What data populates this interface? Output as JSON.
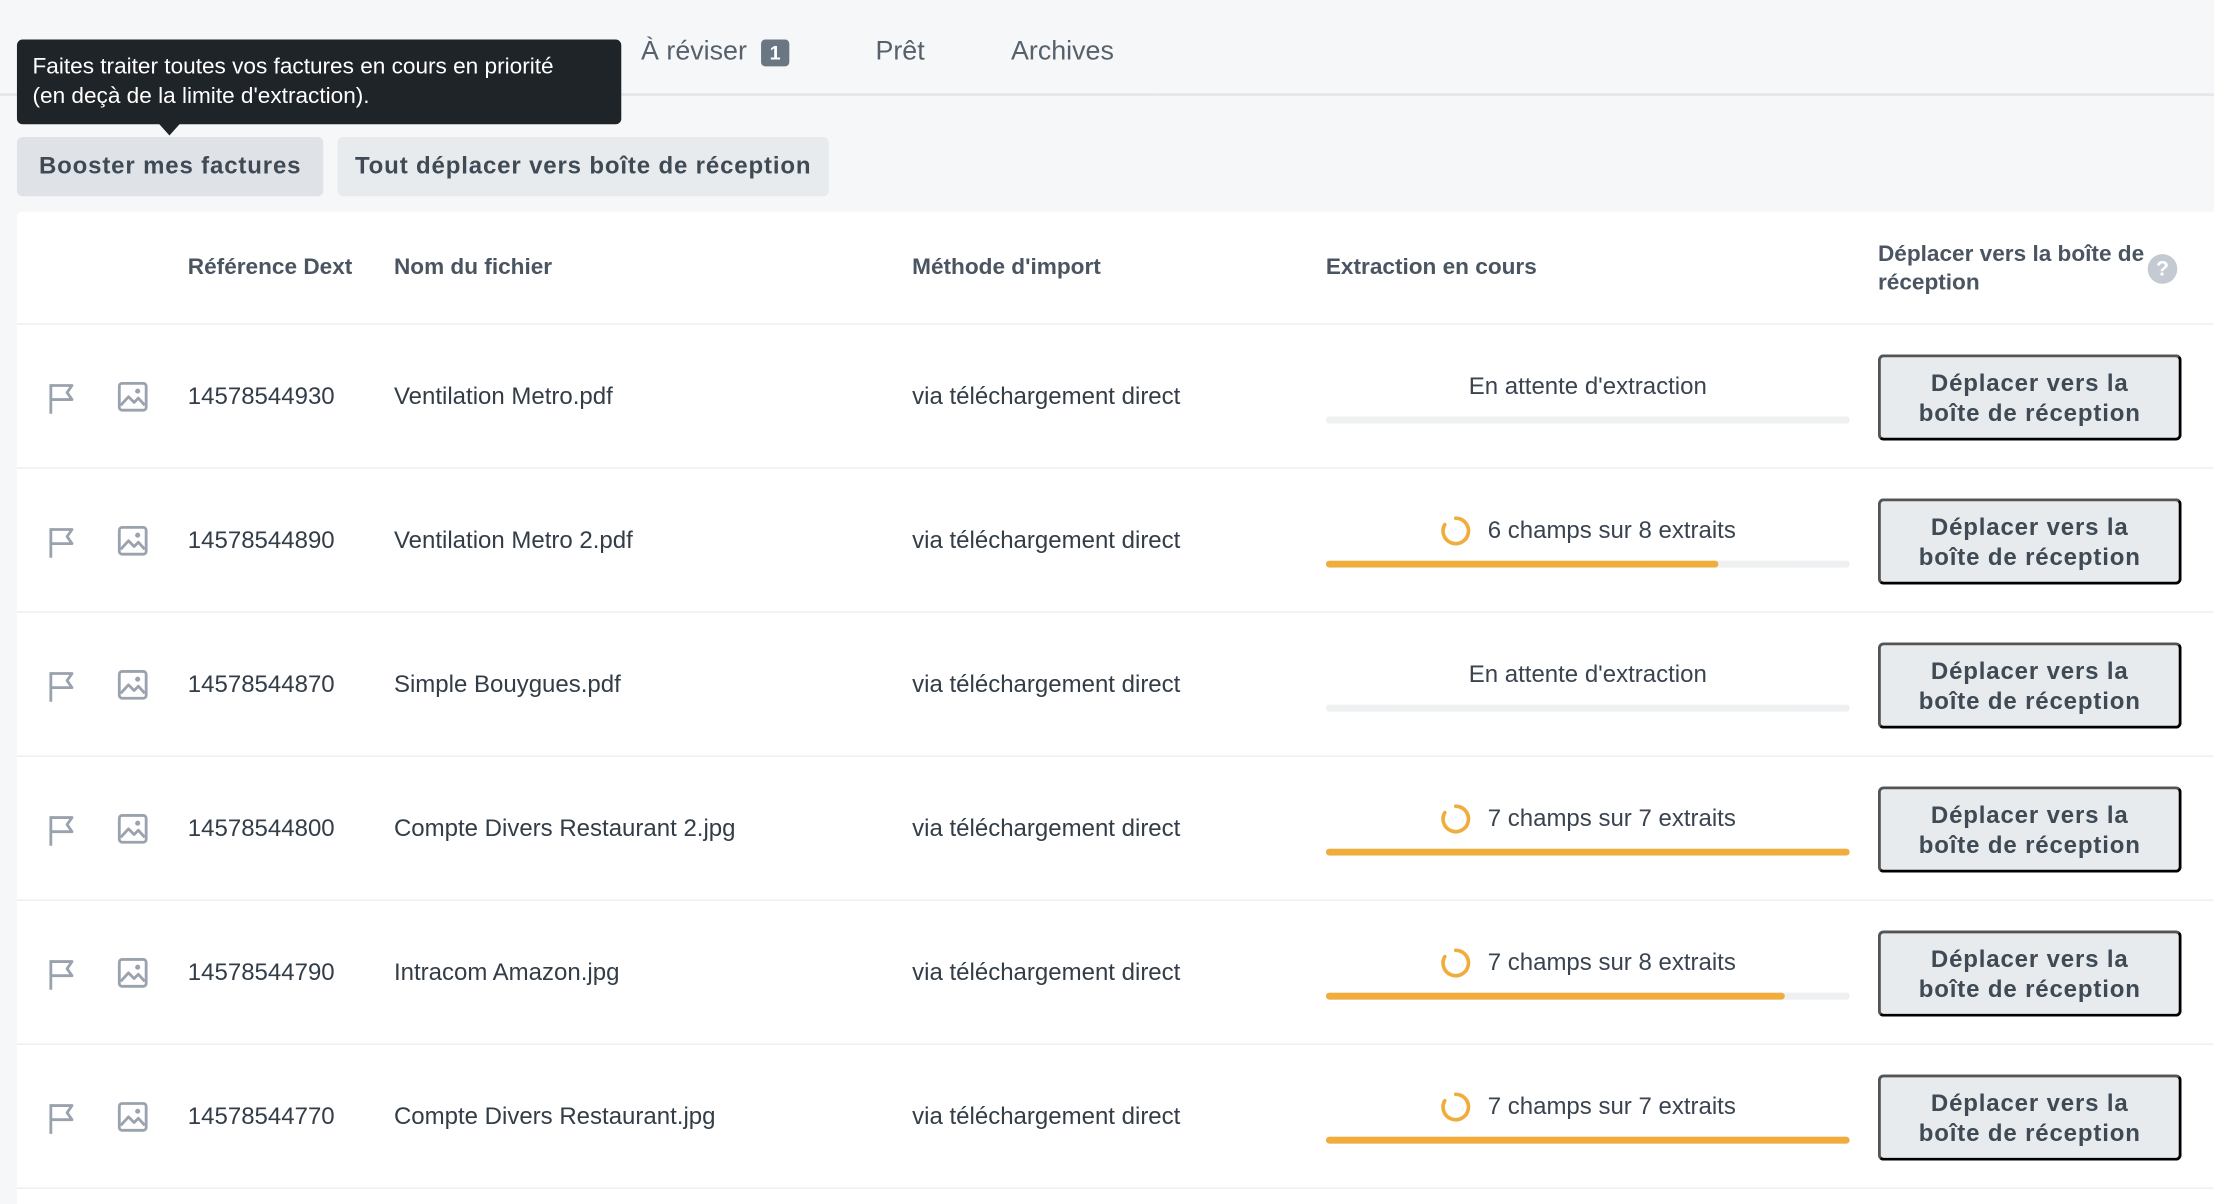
{
  "tabs": [
    {
      "label": "À réviser",
      "badge": "1"
    },
    {
      "label": "Prêt"
    },
    {
      "label": "Archives"
    }
  ],
  "tooltip": {
    "line1": "Faites traiter toutes vos factures en cours en priorité",
    "line2": "(en deçà de la limite d'extraction)."
  },
  "actions": {
    "boost_label": "Booster mes factures",
    "move_all_label": "Tout déplacer vers boîte de réception"
  },
  "table": {
    "headers": {
      "reference": "Référence Dext",
      "filename": "Nom du fichier",
      "import_method": "Méthode d'import",
      "extraction": "Extraction en cours",
      "move_line1": "Déplacer vers la boîte de",
      "move_line2": "réception"
    },
    "help_icon": "?",
    "row_button_line1": "Déplacer vers la",
    "row_button_line2": "boîte de réception",
    "rows": [
      {
        "reference": "14578544930",
        "filename": "Ventilation Metro.pdf",
        "method": "via téléchargement direct",
        "status": "En attente d'extraction",
        "progress": 0,
        "spinner": false
      },
      {
        "reference": "14578544890",
        "filename": "Ventilation Metro 2.pdf",
        "method": "via téléchargement direct",
        "status": "6 champs sur 8 extraits",
        "progress": 0.75,
        "spinner": true
      },
      {
        "reference": "14578544870",
        "filename": "Simple Bouygues.pdf",
        "method": "via téléchargement direct",
        "status": "En attente d'extraction",
        "progress": 0,
        "spinner": false
      },
      {
        "reference": "14578544800",
        "filename": "Compte Divers Restaurant 2.jpg",
        "method": "via téléchargement direct",
        "status": "7 champs sur 7 extraits",
        "progress": 1,
        "spinner": true
      },
      {
        "reference": "14578544790",
        "filename": "Intracom Amazon.jpg",
        "method": "via téléchargement direct",
        "status": "7 champs sur 8 extraits",
        "progress": 0.875,
        "spinner": true
      },
      {
        "reference": "14578544770",
        "filename": "Compte Divers Restaurant.jpg",
        "method": "via téléchargement direct",
        "status": "7 champs sur 7 extraits",
        "progress": 1,
        "spinner": true
      }
    ]
  },
  "icons": {
    "flag": "flag-icon",
    "image": "image-icon",
    "spinner": "spinner-icon",
    "help": "help-icon"
  },
  "colors": {
    "progress": "#f0ad3e",
    "tooltip_bg": "#1f2429",
    "badge_bg": "#6b7683"
  }
}
